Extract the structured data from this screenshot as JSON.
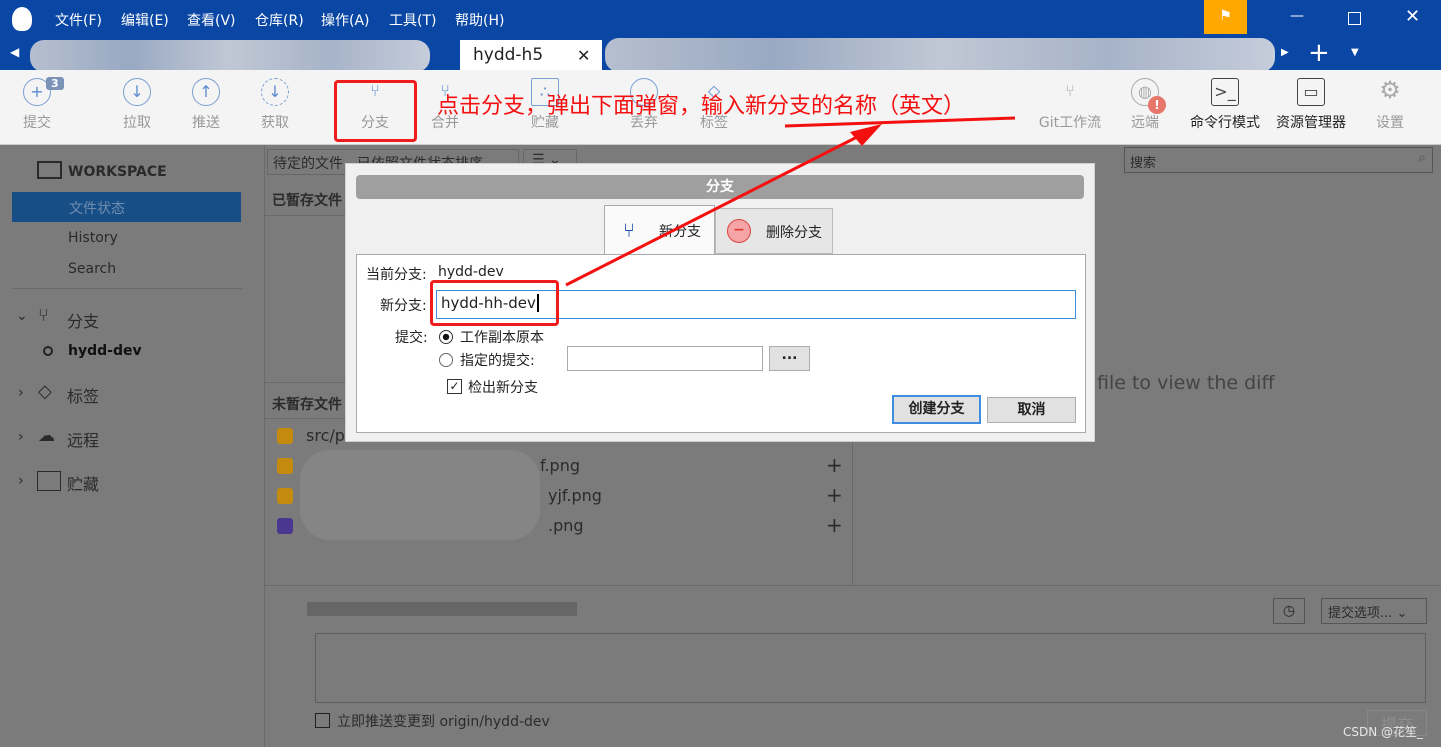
{
  "titlebar": {
    "menus": [
      "文件(F)",
      "编辑(E)",
      "查看(V)",
      "仓库(R)",
      "操作(A)",
      "工具(T)",
      "帮助(H)"
    ],
    "active_tab": "hydd-h5"
  },
  "toolbar": {
    "commit": "提交",
    "commit_badge": "3",
    "pull": "拉取",
    "push": "推送",
    "fetch": "获取",
    "branch": "分支",
    "merge": "合并",
    "stash": "贮藏",
    "discard": "丢弃",
    "tag": "标签",
    "gitflow": "Git工作流",
    "remote": "远端",
    "terminal": "命令行模式",
    "explorer": "资源管理器",
    "settings": "设置"
  },
  "annotation": {
    "text": "点击分支，弹出下面弹窗，输入新分支的名称（英文）",
    "color": "#f51010"
  },
  "sidebar": {
    "workspace": "WORKSPACE",
    "items": [
      "文件状态",
      "History",
      "Search"
    ],
    "branches": "分支",
    "current_branch": "hydd-dev",
    "tags": "标签",
    "remotes": "远程",
    "stashes": "贮藏"
  },
  "filepanel": {
    "sort": "待定的文件，已依照文件状态排序",
    "staged": "已暂存文件",
    "unstaged": "未暂存文件",
    "files": [
      "src/pa",
      "f.png",
      "yjf.png",
      ".png"
    ],
    "search_placeholder": "搜索",
    "diff_hint": "file to view the diff",
    "commit_options": "提交选项...",
    "push_label": "立即推送变更到 origin/hydd-dev",
    "commit_button": "提交"
  },
  "dialog": {
    "title": "分支",
    "tab_new": "新分支",
    "tab_delete": "删除分支",
    "current_label": "当前分支:",
    "current_value": "hydd-dev",
    "new_label": "新分支:",
    "new_value": "hydd-hh-dev",
    "commit_label": "提交:",
    "opt_working": "工作副本原本",
    "opt_specified": "指定的提交:",
    "browse": "...",
    "checkout": "检出新分支",
    "create": "创建分支",
    "cancel": "取消"
  },
  "watermark": "CSDN @花笙_"
}
